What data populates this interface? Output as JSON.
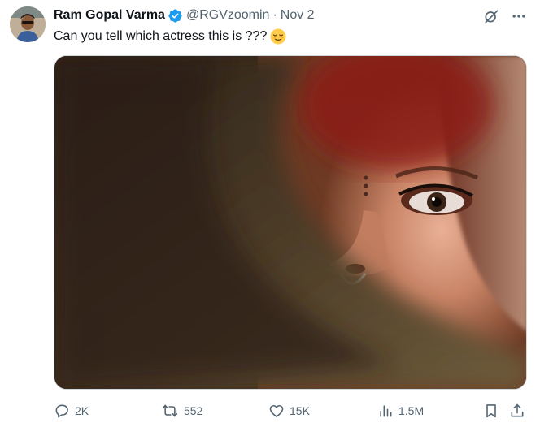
{
  "author": {
    "display_name": "Ram Gopal Varma",
    "handle": "@RGVzoomin",
    "separator": "·",
    "date": "Nov 2"
  },
  "tweet": {
    "text": "Can you tell which actress this is ???"
  },
  "icons": {
    "verified": "verified-badge-icon",
    "grok": "grok-icon",
    "more": "more-icon",
    "reply": "reply-icon",
    "retweet": "retweet-icon",
    "like": "like-icon",
    "views": "views-icon",
    "bookmark": "bookmark-icon",
    "share": "share-icon",
    "emoji": "relieved-face-emoji"
  },
  "stats": {
    "replies": "2K",
    "retweets": "552",
    "likes": "15K",
    "views": "1.5M"
  },
  "colors": {
    "verified": "#1d9bf0",
    "text_primary": "#0f1419",
    "text_secondary": "#536471"
  }
}
